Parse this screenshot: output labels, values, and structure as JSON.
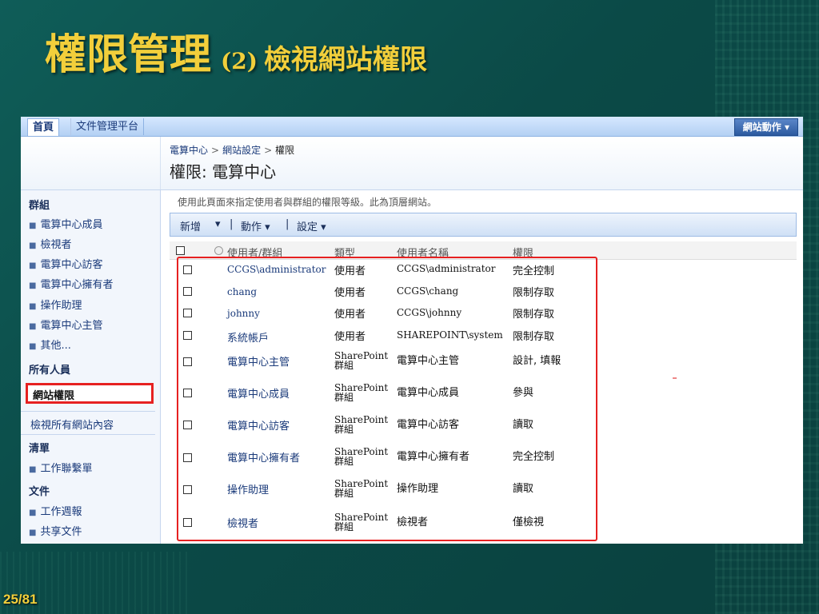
{
  "slide": {
    "title_main": "權限管理",
    "title_num": "(2)",
    "title_sub": "檢視網站權限",
    "page_number": "25/81"
  },
  "topbar": {
    "tab_home": "首頁",
    "tab_doc": "文件管理平台",
    "site_actions": "網站動作 ▾"
  },
  "header": {
    "breadcrumb": [
      "電算中心",
      "網站設定",
      "權限"
    ],
    "breadcrumb_sep": ">",
    "title": "權限: 電算中心"
  },
  "leftnav": {
    "groups_heading": "群組",
    "groups": [
      "電算中心成員",
      "檢視者",
      "電算中心訪客",
      "電算中心擁有者",
      "操作助理",
      "電算中心主管",
      "其他..."
    ],
    "all_people": "所有人員",
    "site_permissions": "網站權限",
    "view_all": "檢視所有網站內容",
    "lists_heading": "清單",
    "lists": [
      "工作聯繫單"
    ],
    "docs_heading": "文件",
    "docs": [
      "工作週報",
      "共享文件"
    ]
  },
  "main": {
    "description": "使用此頁面來指定使用者與群組的權限等級。此為頂層網站。",
    "toolbar": {
      "new": "新增",
      "new_arrow": "▾",
      "sep1": "|",
      "actions": "動作 ▾",
      "sep2": "|",
      "settings": "設定 ▾"
    },
    "columns": [
      "使用者/群組",
      "類型",
      "使用者名稱",
      "權限"
    ],
    "rows": [
      {
        "name": "CCGS\\administrator",
        "type": "使用者",
        "username": "CCGS\\administrator",
        "perm": "完全控制"
      },
      {
        "name": "chang",
        "type": "使用者",
        "username": "CCGS\\chang",
        "perm": "限制存取"
      },
      {
        "name": "johnny",
        "type": "使用者",
        "username": "CCGS\\johnny",
        "perm": "限制存取"
      },
      {
        "name": "系統帳戶",
        "type": "使用者",
        "username": "SHAREPOINT\\system",
        "perm": "限制存取"
      },
      {
        "name": "電算中心主管",
        "type_line1": "SharePoint",
        "type_line2": "群組",
        "username": "電算中心主管",
        "perm": "設計, 填報"
      },
      {
        "name": "電算中心成員",
        "type_line1": "SharePoint",
        "type_line2": "群組",
        "username": "電算中心成員",
        "perm": "參與"
      },
      {
        "name": "電算中心訪客",
        "type_line1": "SharePoint",
        "type_line2": "群組",
        "username": "電算中心訪客",
        "perm": "讀取"
      },
      {
        "name": "電算中心擁有者",
        "type_line1": "SharePoint",
        "type_line2": "群組",
        "username": "電算中心擁有者",
        "perm": "完全控制"
      },
      {
        "name": "操作助理",
        "type_line1": "SharePoint",
        "type_line2": "群組",
        "username": "操作助理",
        "perm": "讀取"
      },
      {
        "name": "檢視者",
        "type_line1": "SharePoint",
        "type_line2": "群組",
        "username": "檢視者",
        "perm": "僅檢視"
      }
    ]
  },
  "colors": {
    "title": "#f2cf3b",
    "highlight": "#e62121",
    "link": "#1a3a7a"
  }
}
